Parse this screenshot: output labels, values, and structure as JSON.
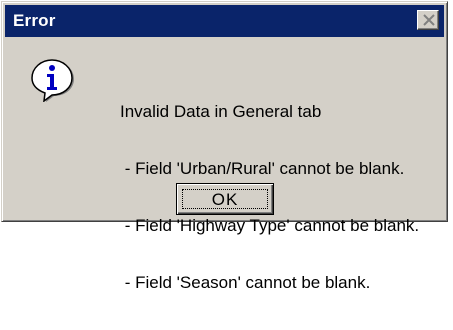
{
  "dialog": {
    "title": "Error",
    "icon": "info-icon",
    "message_lines": [
      "Invalid Data in General tab",
      " - Field 'Urban/Rural' cannot be blank.",
      " - Field 'Highway Type' cannot be blank.",
      " - Field 'Season' cannot be blank."
    ],
    "ok_label": "OK"
  },
  "colors": {
    "titlebar": "#0a246a",
    "face": "#d4d0c8"
  }
}
